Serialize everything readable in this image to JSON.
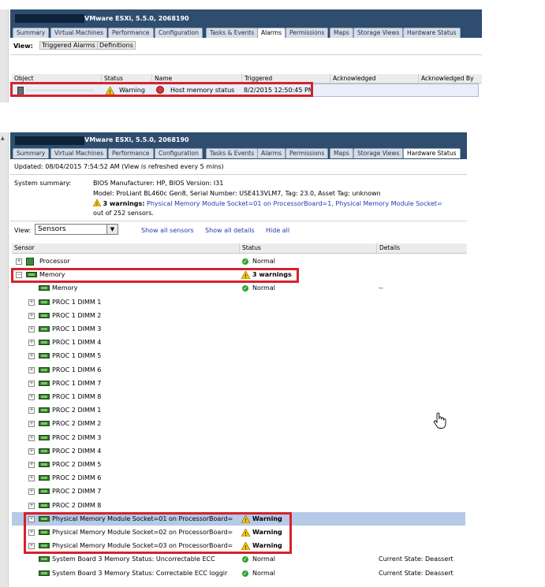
{
  "panel1": {
    "title": "VMware ESXi, 5.5.0, 2068190",
    "tabs": [
      "Summary",
      "Virtual Machines",
      "Performance",
      "Configuration",
      "Tasks & Events",
      "Alarms",
      "Permissions",
      "Maps",
      "Storage Views",
      "Hardware Status"
    ],
    "active_tab": "Alarms",
    "view_label": "View:",
    "view_buttons": [
      "Triggered Alarms",
      "Definitions"
    ],
    "columns": [
      "Object",
      "Status",
      "Name",
      "Triggered",
      "Acknowledged",
      "Acknowledged By"
    ],
    "row": {
      "status": "Warning",
      "name": "Host memory status",
      "triggered": "8/2/2015 12:50:45 PM"
    }
  },
  "panel2": {
    "title": "VMware ESXi, 5.5.0, 2068190",
    "tabs": [
      "Summary",
      "Virtual Machines",
      "Performance",
      "Configuration",
      "Tasks & Events",
      "Alarms",
      "Permissions",
      "Maps",
      "Storage Views",
      "Hardware Status"
    ],
    "active_tab": "Hardware Status",
    "updated": "Updated: 08/04/2015  7:54:52 AM (View is refreshed every 5 mins)",
    "system_summary_label": "System summary:",
    "summary_line1": "BIOS Manufacturer: HP, BIOS Version: I31",
    "summary_line2": "Model: ProLiant BL460c Gen8, Serial Number: USE413VLM7, Tag: 23.0,  Asset Tag: unknown",
    "summary_warn_bold": "3 warnings:",
    "summary_warn_link": "Physical Memory Module Socket=01 on ProcessorBoard=1, Physical Memory Module Socket=",
    "summary_line4": "out of 252 sensors.",
    "view_label": "View:",
    "view_select": "Sensors",
    "links": [
      "Show all sensors",
      "Show all details",
      "Hide all"
    ],
    "columns": [
      "Sensor",
      "Status",
      "Details"
    ],
    "sensors": [
      {
        "name": "Processor",
        "status": "Normal",
        "details": "",
        "level": 0,
        "exp": "+",
        "kind": "proc",
        "stype": "ok"
      },
      {
        "name": "Memory",
        "status": "3 warnings",
        "details": "",
        "level": 0,
        "exp": "−",
        "kind": "chip",
        "stype": "warn"
      },
      {
        "name": "Memory",
        "status": "Normal",
        "details": "--",
        "level": 1,
        "exp": "",
        "kind": "chip",
        "stype": "ok"
      },
      {
        "name": "PROC 1 DIMM 1",
        "status": "",
        "details": "",
        "level": 1,
        "exp": "+",
        "kind": "chip",
        "stype": ""
      },
      {
        "name": "PROC 1 DIMM 2",
        "status": "",
        "details": "",
        "level": 1,
        "exp": "+",
        "kind": "chip",
        "stype": ""
      },
      {
        "name": "PROC 1 DIMM 3",
        "status": "",
        "details": "",
        "level": 1,
        "exp": "+",
        "kind": "chip",
        "stype": ""
      },
      {
        "name": "PROC 1 DIMM 4",
        "status": "",
        "details": "",
        "level": 1,
        "exp": "+",
        "kind": "chip",
        "stype": ""
      },
      {
        "name": "PROC 1 DIMM 5",
        "status": "",
        "details": "",
        "level": 1,
        "exp": "+",
        "kind": "chip",
        "stype": ""
      },
      {
        "name": "PROC 1 DIMM 6",
        "status": "",
        "details": "",
        "level": 1,
        "exp": "+",
        "kind": "chip",
        "stype": ""
      },
      {
        "name": "PROC 1 DIMM 7",
        "status": "",
        "details": "",
        "level": 1,
        "exp": "+",
        "kind": "chip",
        "stype": ""
      },
      {
        "name": "PROC 1 DIMM 8",
        "status": "",
        "details": "",
        "level": 1,
        "exp": "+",
        "kind": "chip",
        "stype": ""
      },
      {
        "name": "PROC 2 DIMM 1",
        "status": "",
        "details": "",
        "level": 1,
        "exp": "+",
        "kind": "chip",
        "stype": ""
      },
      {
        "name": "PROC 2 DIMM 2",
        "status": "",
        "details": "",
        "level": 1,
        "exp": "+",
        "kind": "chip",
        "stype": ""
      },
      {
        "name": "PROC 2 DIMM 3",
        "status": "",
        "details": "",
        "level": 1,
        "exp": "+",
        "kind": "chip",
        "stype": ""
      },
      {
        "name": "PROC 2 DIMM 4",
        "status": "",
        "details": "",
        "level": 1,
        "exp": "+",
        "kind": "chip",
        "stype": ""
      },
      {
        "name": "PROC 2 DIMM 5",
        "status": "",
        "details": "",
        "level": 1,
        "exp": "+",
        "kind": "chip",
        "stype": ""
      },
      {
        "name": "PROC 2 DIMM 6",
        "status": "",
        "details": "",
        "level": 1,
        "exp": "+",
        "kind": "chip",
        "stype": ""
      },
      {
        "name": "PROC 2 DIMM 7",
        "status": "",
        "details": "",
        "level": 1,
        "exp": "+",
        "kind": "chip",
        "stype": ""
      },
      {
        "name": "PROC 2 DIMM 8",
        "status": "",
        "details": "",
        "level": 1,
        "exp": "+",
        "kind": "chip",
        "stype": ""
      },
      {
        "name": "Physical Memory Module Socket=01 on ProcessorBoard=",
        "status": "Warning",
        "details": "",
        "level": 1,
        "exp": "+",
        "kind": "chip",
        "stype": "warn",
        "selected": true
      },
      {
        "name": "Physical Memory Module Socket=02 on ProcessorBoard=",
        "status": "Warning",
        "details": "",
        "level": 1,
        "exp": "+",
        "kind": "chip",
        "stype": "warn"
      },
      {
        "name": "Physical Memory Module Socket=03 on ProcessorBoard=",
        "status": "Warning",
        "details": "",
        "level": 1,
        "exp": "+",
        "kind": "chip",
        "stype": "warn"
      },
      {
        "name": "System Board 3 Memory Status: Uncorrectable ECC",
        "status": "Normal",
        "details": "Current State: Deassert",
        "level": 1,
        "exp": "",
        "kind": "chip",
        "stype": "ok"
      },
      {
        "name": "System Board 3 Memory Status: Correctable ECC loggir",
        "status": "Normal",
        "details": "Current State: Deassert",
        "level": 1,
        "exp": "",
        "kind": "chip",
        "stype": "ok"
      }
    ]
  },
  "colors": {
    "titlebar": "#2f4d6e",
    "highlight": "#d6222d",
    "selected_row": "#b6c9e6",
    "link": "#1f3ab8"
  }
}
